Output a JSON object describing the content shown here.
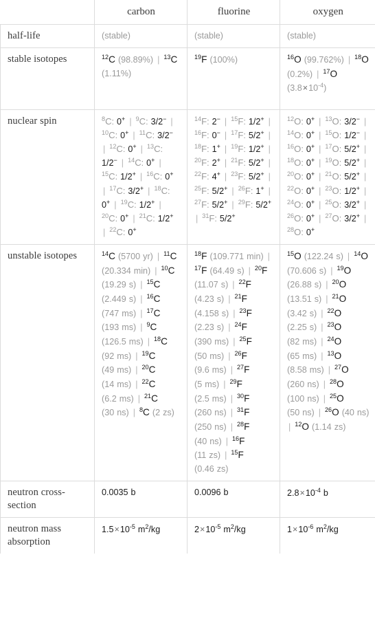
{
  "table": {
    "columns": [
      "",
      "carbon",
      "fluorine",
      "oxygen"
    ],
    "header": {
      "corner": "",
      "carbon": "carbon",
      "fluorine": "fluorine",
      "oxygen": "oxygen"
    },
    "rows": [
      {
        "label": "half-life",
        "carbon": "(stable)",
        "fluorine": "(stable)",
        "oxygen": "(stable)"
      },
      {
        "label": "stable isotopes",
        "carbon": "12C (98.89%) | 13C (1.11%)",
        "fluorine": "19F (100%)",
        "oxygen": "16O (99.762%) | 18O (0.2%) | 17O (3.8×10^-4)"
      },
      {
        "label": "nuclear spin",
        "carbon": "8C: 0+ | 9C: 3/2- | 10C: 0+ | 11C: 3/2- | 12C: 0+ | 13C: 1/2- | 14C: 0+ | 15C: 1/2+ | 16C: 0+ | 17C: 3/2+ | 18C: 0+ | 19C: 1/2+ | 20C: 0+ | 21C: 1/2+ | 22C: 0+",
        "fluorine": "14F: 2- | 15F: 1/2+ | 16F: 0- | 17F: 5/2+ | 18F: 1+ | 19F: 1/2+ | 20F: 2+ | 21F: 5/2+ | 22F: 4+ | 23F: 5/2+ | 25F: 5/2+ | 26F: 1+ | 27F: 5/2+ | 29F: 5/2+ | 31F: 5/2+",
        "oxygen": "12O: 0+ | 13O: 3/2- | 14O: 0+ | 15O: 1/2- | 16O: 0+ | 17O: 5/2+ | 18O: 0+ | 19O: 5/2+ | 20O: 0+ | 21O: 5/2+ | 22O: 0+ | 23O: 1/2+ | 24O: 0+ | 25O: 3/2+ | 26O: 0+ | 27O: 3/2+ | 28O: 0+"
      },
      {
        "label": "unstable isotopes",
        "carbon": "14C (5700 yr) | 11C (20.334 min) | 10C (19.29 s) | 15C (2.449 s) | 16C (747 ms) | 17C (193 ms) | 9C (126.5 ms) | 18C (92 ms) | 19C (49 ms) | 20C (14 ms) | 22C (6.2 ms) | 21C (30 ns) | 8C (2 zs)",
        "fluorine": "18F (109.771 min) | 17F (64.49 s) | 20F (11.07 s) | 22F (4.23 s) | 21F (4.158 s) | 23F (2.23 s) | 24F (390 ms) | 25F (50 ms) | 26F (9.6 ms) | 27F (5 ms) | 29F (2.5 ms) | 30F (260 ns) | 31F (250 ns) | 28F (40 ns) | 16F (11 zs) | 15F (0.46 zs)",
        "oxygen": "15O (122.24 s) | 14O (70.606 s) | 19O (26.88 s) | 20O (13.51 s) | 21O (3.42 s) | 22O (2.25 s) | 23O (82 ms) | 24O (65 ms) | 13O (8.58 ms) | 27O (260 ns) | 28O (100 ns) | 25O (50 ns) | 26O (40 ns) | 12O (1.14 zs)"
      },
      {
        "label": "neutron cross-section",
        "carbon": "0.0035 b",
        "fluorine": "0.0096 b",
        "oxygen": "2.8×10^-4 b"
      },
      {
        "label": "neutron mass absorption",
        "carbon": "1.5×10^-5 m^2/kg",
        "fluorine": "2×10^-5 m^2/kg",
        "oxygen": "1×10^-6 m^2/kg"
      }
    ],
    "row_labels": {
      "half_life": "half-life",
      "stable_isotopes": "stable isotopes",
      "nuclear_spin": "nuclear spin",
      "unstable_isotopes": "unstable isotopes",
      "neutron_cross_section": "neutron cross-section",
      "neutron_mass_absorption": "neutron mass absorption"
    },
    "stable_text": "(stable)",
    "colors": {
      "border": "#dcdcdc",
      "text": "#1a1a1a",
      "muted": "#9a9a9a",
      "label": "#3b3b3b",
      "background": "#ffffff"
    }
  }
}
